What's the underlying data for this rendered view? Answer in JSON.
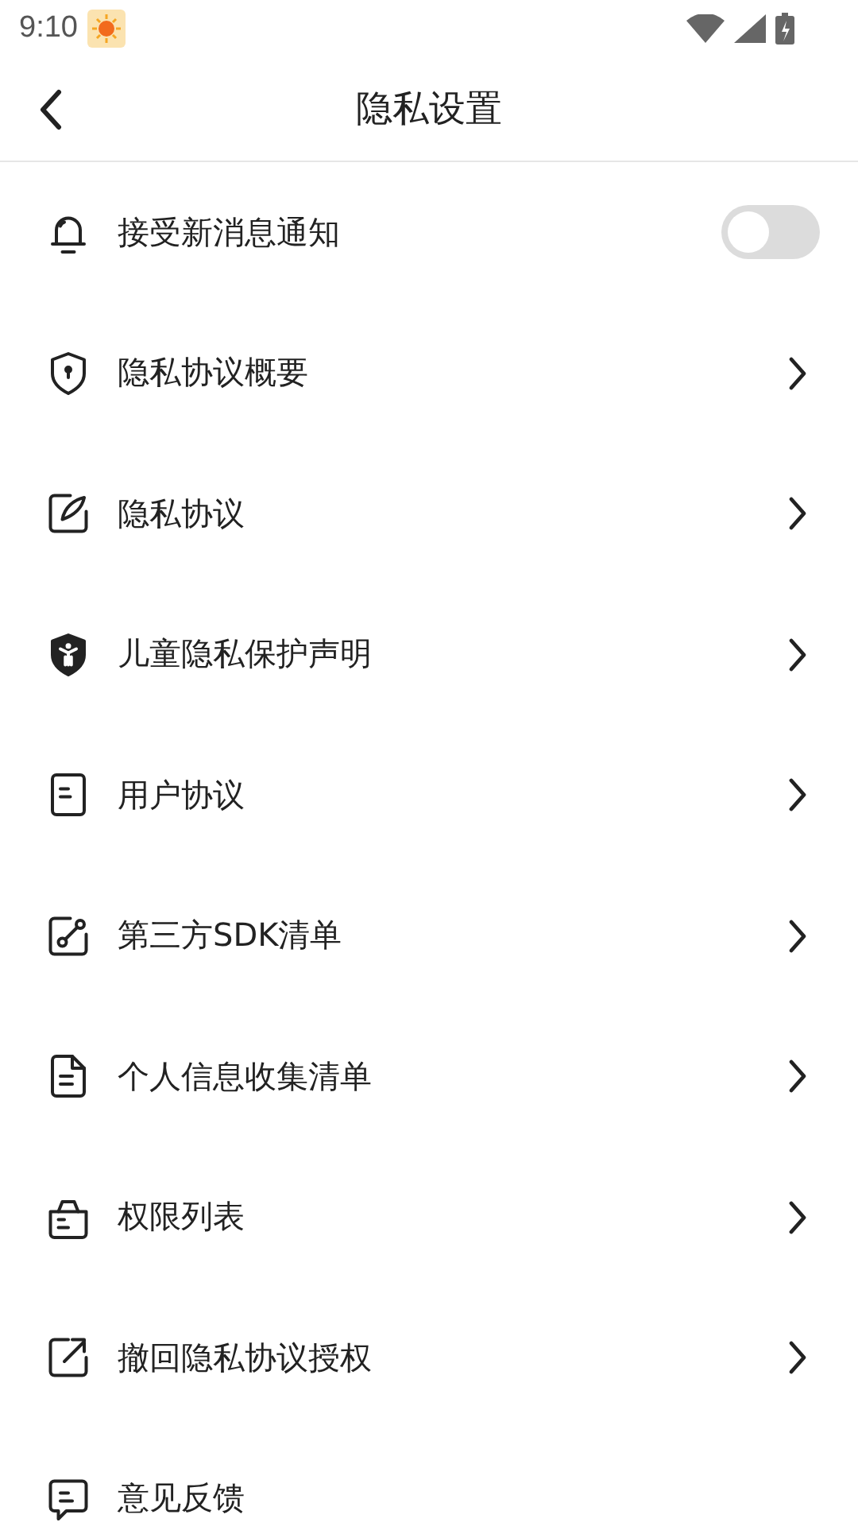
{
  "status_bar": {
    "time": "9:10"
  },
  "header": {
    "title": "隐私设置"
  },
  "items": [
    {
      "kind": "toggle",
      "label": "接受新消息通知",
      "on": false
    },
    {
      "kind": "link",
      "label": "隐私协议概要"
    },
    {
      "kind": "link",
      "label": "隐私协议"
    },
    {
      "kind": "link",
      "label": "儿童隐私保护声明"
    },
    {
      "kind": "link",
      "label": "用户协议"
    },
    {
      "kind": "link",
      "label": "第三方SDK清单"
    },
    {
      "kind": "link",
      "label": "个人信息收集清单"
    },
    {
      "kind": "link",
      "label": "权限列表"
    },
    {
      "kind": "link",
      "label": "撤回隐私协议授权"
    },
    {
      "kind": "plain",
      "label": "意见反馈"
    }
  ]
}
